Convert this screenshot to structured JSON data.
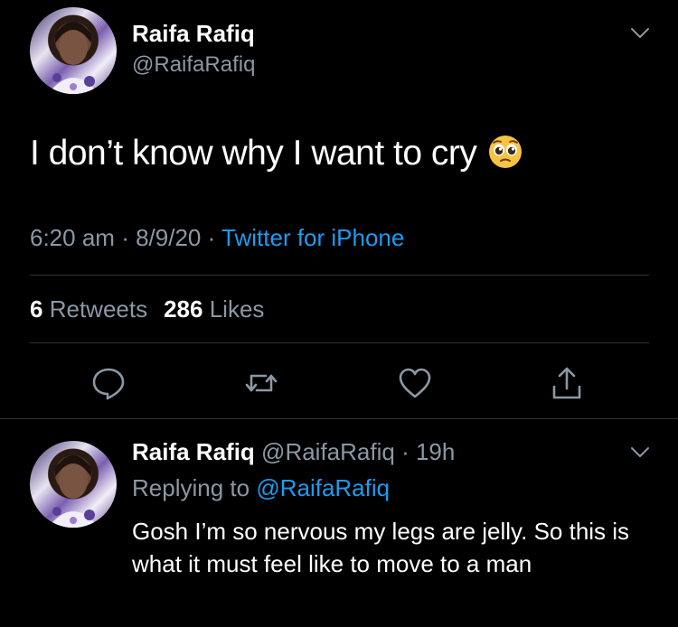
{
  "main_tweet": {
    "display_name": "Raifa Rafiq",
    "handle": "@RaifaRafiq",
    "text": "I don’t know why I want to cry",
    "emoji": "pleading-face",
    "time": "6:20 am",
    "date": "8/9/20",
    "source": "Twitter for iPhone",
    "retweets_count": "6",
    "retweets_label": "Retweets",
    "likes_count": "286",
    "likes_label": "Likes"
  },
  "reply_tweet": {
    "display_name": "Raifa Rafiq",
    "handle": "@RaifaRafiq",
    "age": "19h",
    "replying_label": "Replying to",
    "replying_to": "@RaifaRafiq",
    "text": "Gosh I’m so nervous my legs are jelly. So this is what it must feel like to move to a man"
  },
  "icons": {
    "reply": "speech-bubble-icon",
    "retweet": "retweet-icon",
    "like": "heart-icon",
    "share": "share-icon",
    "more": "chevron-down-icon"
  },
  "colors": {
    "background": "#000000",
    "text": "#ffffff",
    "muted": "#8b98a5",
    "link": "#1d9bf0",
    "divider": "#2f3336"
  }
}
